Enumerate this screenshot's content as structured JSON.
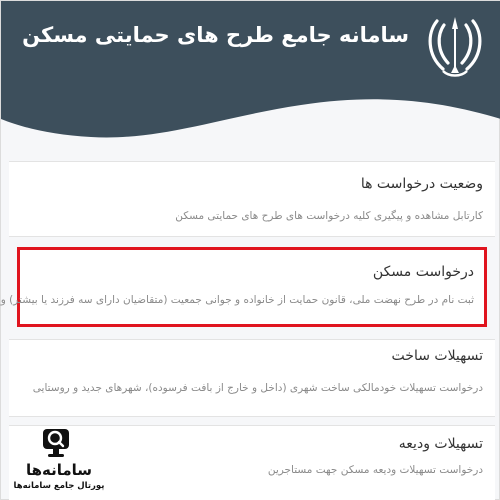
{
  "header": {
    "title": "سامانه جامع طرح های حمایتی مسکن",
    "emblem_icon": "iran-emblem-icon",
    "background_color": "#3d4f5c"
  },
  "services": [
    {
      "title": "وضعیت درخواست ها",
      "description": "کارتابل مشاهده و پیگیری کلیه درخواست های طرح های حمایتی مسکن",
      "highlighted": false
    },
    {
      "title": "درخواست مسکن",
      "description": "ثبت نام در طرح نهضت ملی، قانون حمایت از خانواده و جوانی جمعیت (متقاضیان دارای سه فرزند یا بیشتر) و ...",
      "highlighted": true
    },
    {
      "title": "تسهیلات ساخت",
      "description": "درخواست تسهیلات خودمالکی ساخت شهری (داخل و خارج از بافت فرسوده)، شهرهای جدید و روستایی",
      "highlighted": false
    },
    {
      "title": "تسهیلات ودیعه",
      "description": "درخواست تسهیلات ودیعه مسکن جهت مستاجرین",
      "highlighted": false
    }
  ],
  "watermark": {
    "brand": "سامانه‌ها",
    "subtitle": "پورتال جامع سامانه‌ها",
    "icon": "magnifier-monitor-icon"
  },
  "colors": {
    "highlight_border": "#e0141e",
    "header_bg": "#3d4f5c"
  }
}
